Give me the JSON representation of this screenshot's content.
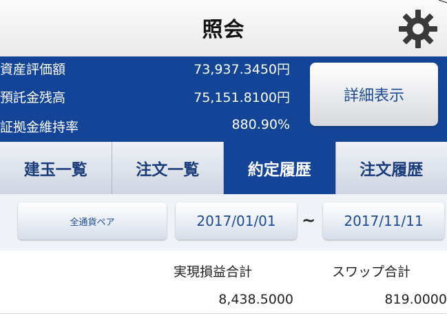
{
  "header": {
    "title": "照会",
    "settings_icon": "gear-icon"
  },
  "account": {
    "rows": [
      {
        "label": "資産評価額",
        "value": "73,937.3450円"
      },
      {
        "label": "預託金残高",
        "value": "75,151.8100円"
      },
      {
        "label": "証拠金維持率",
        "value": "880.90%"
      }
    ],
    "detail_button": "詳細表示"
  },
  "tabs": [
    {
      "label": "建玉一覧",
      "active": false
    },
    {
      "label": "注文一覧",
      "active": false
    },
    {
      "label": "約定履歴",
      "active": true
    },
    {
      "label": "注文履歴",
      "active": false
    }
  ],
  "filter": {
    "currency_pair": "全通貨ペア",
    "date_from": "2017/01/01",
    "separator": "~",
    "date_to": "2017/11/11"
  },
  "summary": {
    "headers": [
      "実現損益合計",
      "スワップ合計"
    ],
    "values": [
      "8,438.5000",
      "819.0000"
    ]
  },
  "colors": {
    "brand_blue": "#134497",
    "button_text": "#1c4a92"
  }
}
